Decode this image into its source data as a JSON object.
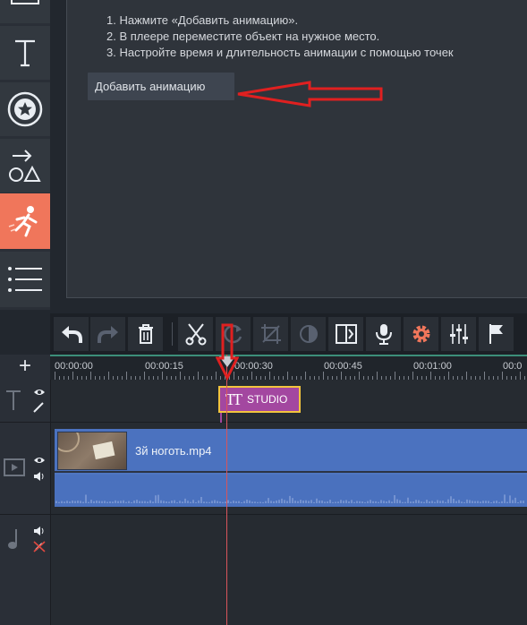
{
  "instructions": {
    "steps": [
      "1. Нажмите «Добавить анимацию».",
      "2. В плеере переместите объект на нужное место.",
      "3. Настройте время и длительность анимации с помощью точек"
    ],
    "add_button": "Добавить анимацию"
  },
  "sidebar": {
    "items": [
      {
        "name": "media-icon"
      },
      {
        "name": "titles-icon",
        "glyph": "T"
      },
      {
        "name": "stickers-icon"
      },
      {
        "name": "shapes-icon"
      },
      {
        "name": "animation-icon",
        "active": true
      },
      {
        "name": "chapters-icon"
      }
    ]
  },
  "toolbar": {
    "buttons": [
      "undo-icon",
      "redo-icon",
      "delete-icon",
      "cut-icon",
      "rotate-icon",
      "crop-icon",
      "color-icon",
      "transitions-icon",
      "voice-icon",
      "settings-icon",
      "equalizer-icon",
      "marker-icon"
    ]
  },
  "timeline": {
    "add_track": "+",
    "ticks": [
      "00:00:00",
      "00:00:15",
      "00:00:30",
      "00:00:45",
      "00:01:00",
      "00:0"
    ],
    "title_clip": "STUDIO",
    "title_clip_glyph": "TT",
    "video_clip": "3й ноготь.mp4"
  },
  "colors": {
    "accent": "#f0765b",
    "video_clip": "#4f76c2",
    "title_clip": "#a347a0",
    "annotation_arrow": "#e02020"
  }
}
